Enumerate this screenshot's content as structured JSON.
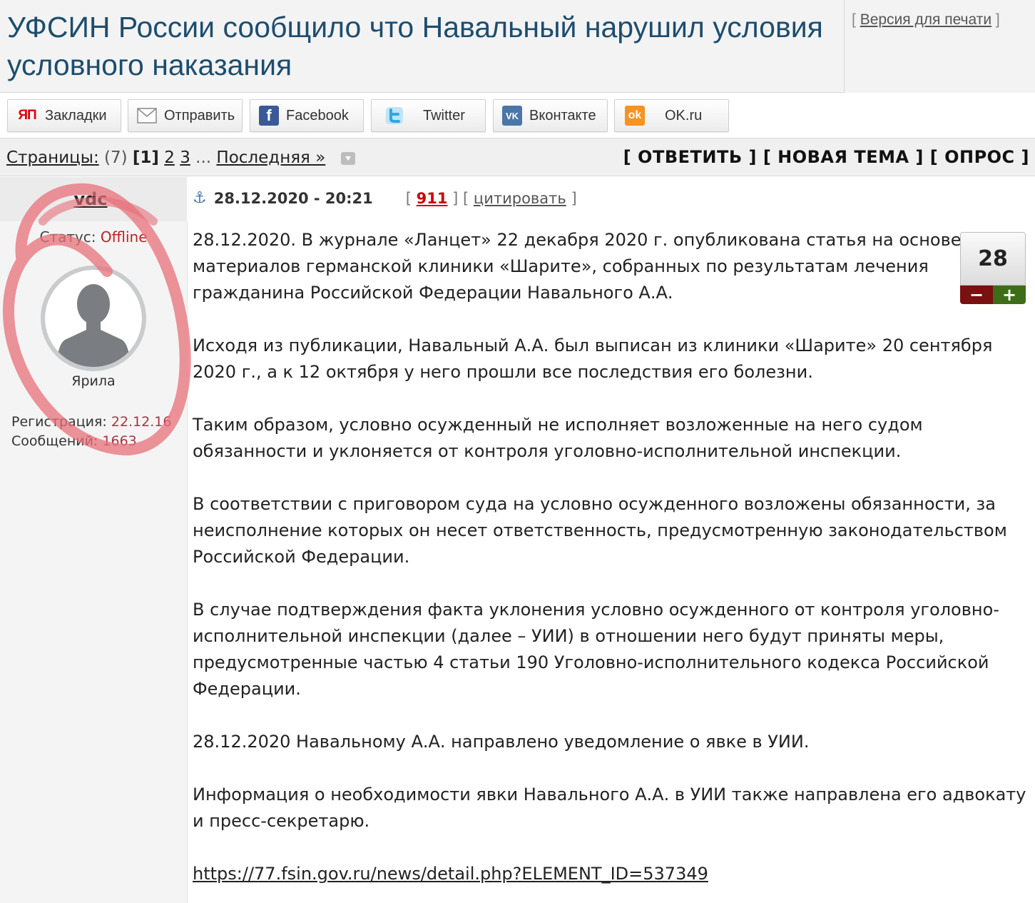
{
  "header": {
    "title": "УФСИН России сообщило что Навальный нарушил условия условного наказания",
    "print_open": "[",
    "print_label": "Версия для печати",
    "print_close": "]"
  },
  "share": {
    "bookmarks": "Закладки",
    "send": "Отправить",
    "facebook": "Facebook",
    "twitter": "Twitter",
    "vkontakte": "Вконтакте",
    "okru": "OK.ru",
    "bookmarks_icon_text": "ЯП",
    "facebook_icon_text": "f",
    "vk_icon_text": "VK",
    "ok_icon_text": "ok"
  },
  "pager": {
    "label": "Страницы:",
    "count": "(7)",
    "current": "[1]",
    "page2": "2",
    "page3": "3",
    "ellipsis": "...",
    "last": "Последняя »"
  },
  "actions": {
    "reply": "[ ОТВЕТИТЬ ]",
    "new_topic": "[ НОВАЯ ТЕМА ]",
    "poll": "[ ОПРОС ]"
  },
  "post": {
    "author": "vdc",
    "date": "28.12.2020 - 20:21",
    "post_number": "911",
    "quote_label": "цитировать",
    "status_label": "Статус:",
    "status_value": "Offline",
    "rank": "Ярила",
    "reg_label": "Регистрация:",
    "reg_value": "22.12.16",
    "messages_label": "Сообщений:",
    "messages_value": "1663",
    "rating": "28",
    "minus": "−",
    "plus": "+",
    "paragraphs": [
      "28.12.2020. В журнале «Ланцет» 22 декабря 2020 г. опубликована статья на основе материалов германской клиники «Шарите», собранных по результатам лечения гражданина Российской Федерации Навального А.А.",
      "Исходя из публикации, Навальный А.А. был выписан из клиники «Шарите» 20 сентября 2020 г., а к 12 октября у него прошли все последствия его болезни.",
      "Таким образом, условно осужденный не исполняет возложенные на него судом обязанности и уклоняется от контроля уголовно-исполнительной инспекции.",
      "В соответствии с приговором суда на условно осужденного возложены обязанности, за неисполнение которых он несет ответственность, предусмотренную законодательством Российской Федерации.",
      "В случае подтверждения факта уклонения условно осужденного от контроля уголовно-исполнительной инспекции (далее – УИИ) в отношении него будут приняты меры, предусмотренные частью 4 статьи 190 Уголовно-исполнительного кодекса Российской Федерации.",
      "28.12.2020 Навальному А.А. направлено уведомление о явке в УИИ.",
      "Информация о необходимости явки Навального А.А. в УИИ также направлена его адвокату и пресс-секретарю."
    ],
    "link": "https://77.fsin.gov.ru/news/detail.php?ELEMENT_ID=537349"
  },
  "colors": {
    "title": "#1d4d6e",
    "offline": "#b22222",
    "post_number": "#cc0000",
    "annotation": "#e8707a",
    "vote_minus": "#7a1010",
    "vote_plus": "#3d6e17"
  },
  "icons": {
    "anchor": "anchor-icon",
    "dropdown": "dropdown-arrow-icon",
    "avatar": "default-avatar-icon"
  }
}
